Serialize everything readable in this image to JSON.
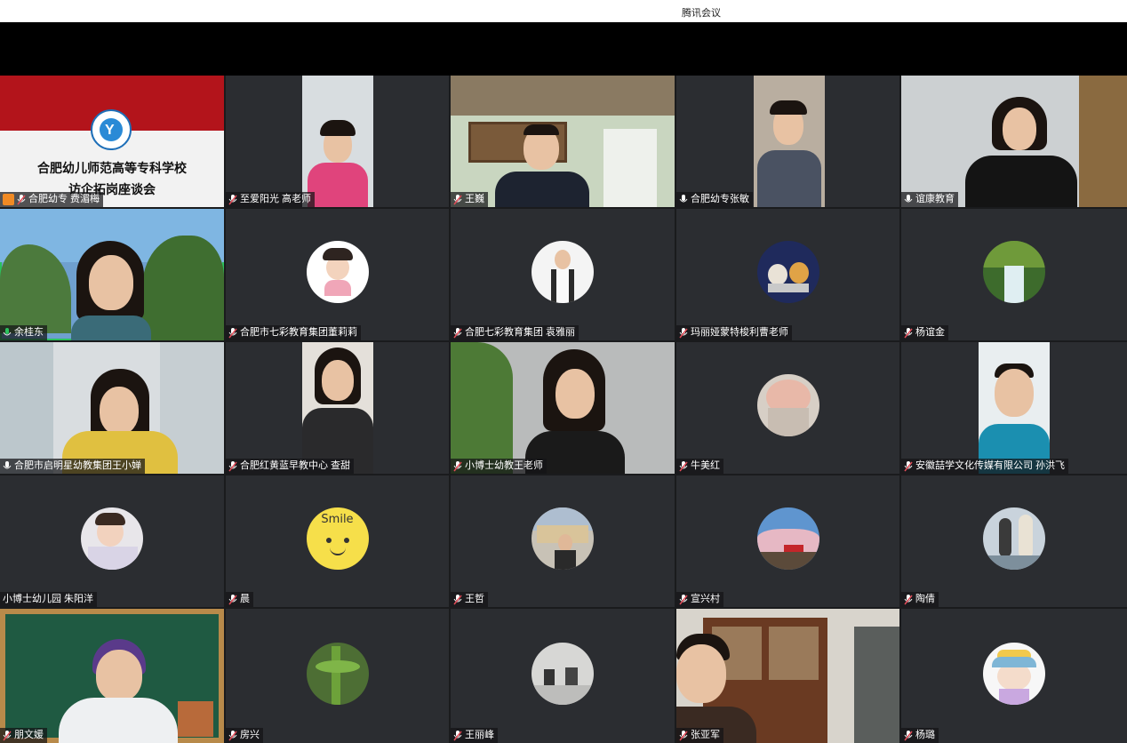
{
  "app": {
    "title": "腾讯会议"
  },
  "slide": {
    "line1": "合肥幼儿师范高等专科学校",
    "line2": "访企拓岗座谈会"
  },
  "participants": [
    {
      "name": "合肥幼专 费湄梅",
      "mic": "muted",
      "host": true
    },
    {
      "name": "至爱阳光  高老师",
      "mic": "muted"
    },
    {
      "name": "王巍",
      "mic": "muted"
    },
    {
      "name": "合肥幼专张敏",
      "mic": "on"
    },
    {
      "name": "谊康教育",
      "mic": "on"
    },
    {
      "name": "余桂东",
      "mic": "speaking"
    },
    {
      "name": "合肥市七彩教育集团董莉莉",
      "mic": "muted"
    },
    {
      "name": "合肥七彩教育集团 袁雅丽",
      "mic": "muted"
    },
    {
      "name": "玛丽娅蒙特梭利曹老师",
      "mic": "muted"
    },
    {
      "name": "杨谊金",
      "mic": "muted"
    },
    {
      "name": "合肥市启明星幼教集团王小婵",
      "mic": "on"
    },
    {
      "name": "合肥红黄蓝早教中心 查甜",
      "mic": "muted"
    },
    {
      "name": "小博士幼教王老师",
      "mic": "muted"
    },
    {
      "name": "牛美红",
      "mic": "muted"
    },
    {
      "name": "安徽喆学文化传媒有限公司 孙洪飞",
      "mic": "muted"
    },
    {
      "name": "小博士幼儿园 朱阳洋",
      "mic": "none"
    },
    {
      "name": "晨",
      "mic": "muted"
    },
    {
      "name": "王哲",
      "mic": "muted"
    },
    {
      "name": "宣兴村",
      "mic": "muted"
    },
    {
      "name": "陶倩",
      "mic": "muted"
    },
    {
      "name": "朋文媛",
      "mic": "muted"
    },
    {
      "name": "房兴",
      "mic": "muted"
    },
    {
      "name": "王丽峰",
      "mic": "muted"
    },
    {
      "name": "张亚军",
      "mic": "muted"
    },
    {
      "name": "杨璐",
      "mic": "muted"
    }
  ],
  "avatar_texts": {
    "smile": "Smile"
  },
  "colors": {
    "speaking": "#2bc25e",
    "muted": "#e34d59",
    "tile": "#2b2d31"
  }
}
